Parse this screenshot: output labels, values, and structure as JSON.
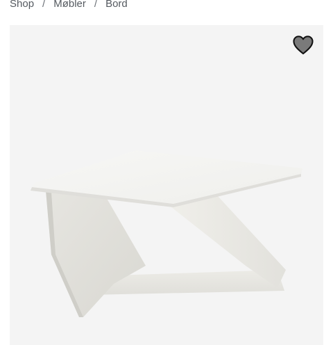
{
  "breadcrumb": {
    "items": [
      "Shop",
      "Møbler",
      "Bord"
    ],
    "separator": "/"
  },
  "product_gallery": {
    "image_alt": "White metal side table",
    "favorite_icon": "heart-icon",
    "colors": {
      "background": "#f4f4f4",
      "heart_fill": "#7a7a7a",
      "heart_stroke": "#111111"
    }
  }
}
